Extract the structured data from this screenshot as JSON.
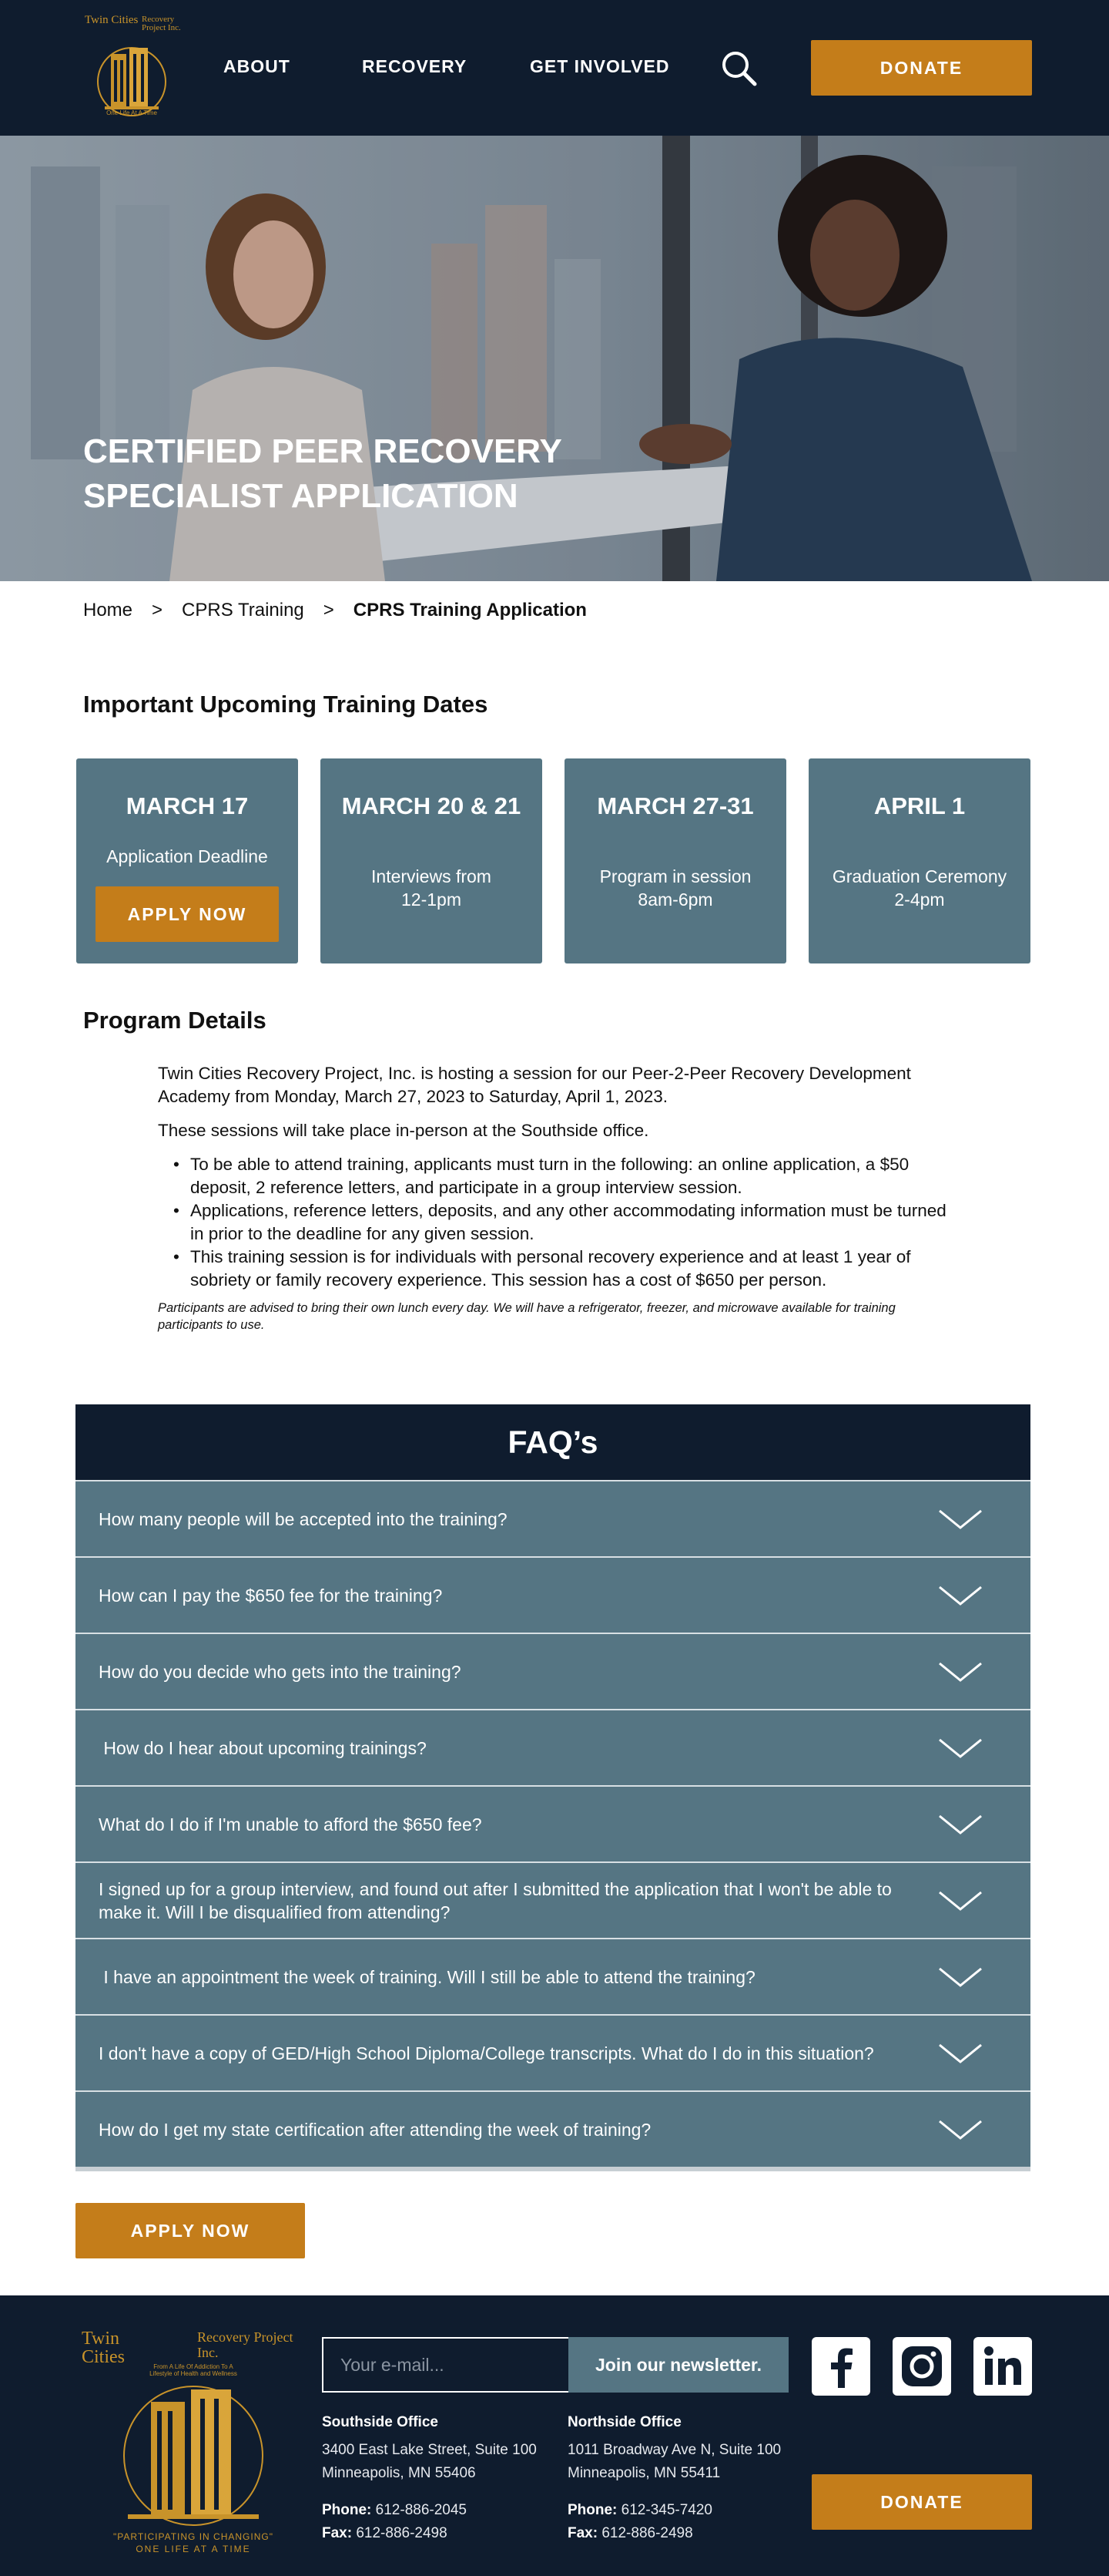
{
  "colors": {
    "navy": "#0f1c2e",
    "slate": "#557583",
    "gold": "#c47d1a"
  },
  "header": {
    "logo": {
      "line1": "Twin Cities",
      "line2": "Recovery Project Inc.",
      "tagline": "One Life At A Time"
    },
    "nav": [
      "ABOUT",
      "RECOVERY",
      "GET INVOLVED"
    ],
    "search_icon": "search-icon",
    "donate_label": "DONATE"
  },
  "hero": {
    "title": "CERTIFIED PEER RECOVERY SPECIALIST APPLICATION"
  },
  "breadcrumb": {
    "home": "Home",
    "separator": ">",
    "training": "CPRS Training",
    "current": "CPRS Training Application"
  },
  "dates": {
    "heading": "Important  Upcoming Training Dates",
    "cards": [
      {
        "date": "MARCH 17",
        "desc": "Application Deadline",
        "button": "APPLY NOW"
      },
      {
        "date": "MARCH 20 & 21",
        "desc_line1": "Interviews from",
        "desc_line2": "12-1pm"
      },
      {
        "date": "MARCH 27-31",
        "desc_line1": "Program in session",
        "desc_line2": "8am-6pm"
      },
      {
        "date": "APRIL 1",
        "desc_line1": "Graduation Ceremony",
        "desc_line2": "2-4pm"
      }
    ]
  },
  "program": {
    "heading": "Program Details",
    "intro": "Twin Cities Recovery Project, Inc. is hosting a session for our Peer-2-Peer Recovery Development Academy from Monday, March 27,  2023 to Saturday, April 1, 2023.",
    "location": "These sessions will take place in-person at the Southside office.",
    "bullets": [
      "To be able to attend training, applicants must turn in the following: an online application, a $50 deposit, 2 reference letters, and participate in a group interview session.",
      "Applications, reference letters, deposits, and any other accommodating information must be turned in prior to the deadline for any given session.",
      "This training session is for individuals with personal recovery experience and at least 1 year of sobriety or family recovery experience. This session has a cost of $650 per person."
    ],
    "note": "Participants are advised to bring their own lunch every day. We will have a refrigerator, freezer, and microwave available for training participants to use."
  },
  "faq": {
    "title": "FAQ’s",
    "items": [
      "How many people will be accepted into the training?",
      "How can I pay the $650 fee for the training?",
      "How do you decide who gets into the training?",
      " How do I hear about upcoming trainings?",
      "What do I do if I'm unable to afford the $650 fee?",
      "I signed up for a group interview, and found out after I submitted the application that I won't be able to make it. Will I be disqualified from attending?",
      " I have an appointment the week of training. Will I still be able to attend the training?",
      "I don't have a copy of GED/High School Diploma/College transcripts. What do I do in this situation?",
      "How do I get my state certification after attending the week of training?"
    ],
    "expand_icon": "chevron-down-icon"
  },
  "apply_bottom_label": "APPLY NOW",
  "footer": {
    "logo": {
      "line1": "Twin Cities",
      "line2": "Recovery Project Inc.",
      "arc": "From A Life Of Addiction To A Lifestyle of Health and Wellness",
      "bottom1": "\"PARTICIPATING IN CHANGING\"",
      "bottom2": "ONE LIFE AT A TIME"
    },
    "newsletter": {
      "placeholder": "Your e-mail...",
      "button": "Join our newsletter."
    },
    "southside": {
      "name": "Southside Office",
      "street": "3400 East Lake Street, Suite 100",
      "city": "Minneapolis, MN 55406",
      "phone_label": "Phone:",
      "phone": "612-886-2045",
      "fax_label": "Fax:",
      "fax": "612-886-2498"
    },
    "northside": {
      "name": "Northside Office",
      "street": "1011 Broadway Ave N, Suite 100",
      "city": "Minneapolis, MN 55411",
      "phone_label": "Phone:",
      "phone": "612-345-7420",
      "fax_label": "Fax:",
      "fax": "612-886-2498"
    },
    "social_icons": [
      "facebook-icon",
      "instagram-icon",
      "linkedin-icon"
    ],
    "donate_label": "DONATE"
  }
}
